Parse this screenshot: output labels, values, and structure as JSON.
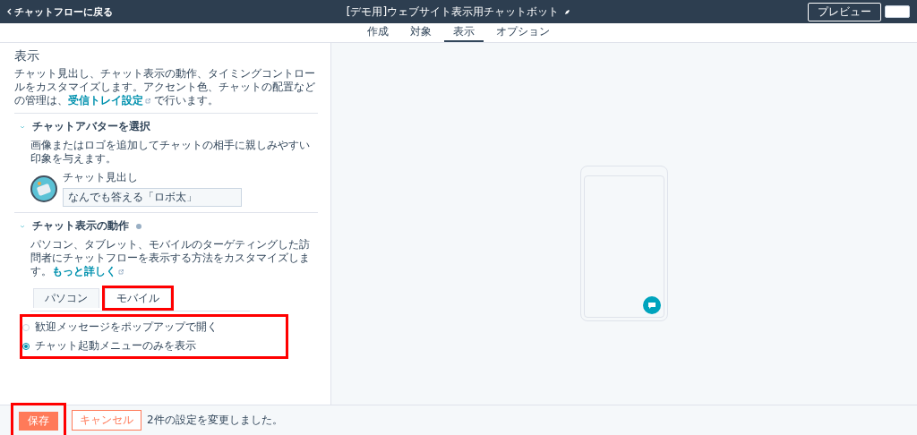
{
  "header": {
    "back_link": "チャットフローに戻る",
    "title": "[デモ用]ウェブサイト表示用チャットボット",
    "preview_button": "プレビュー"
  },
  "tabs": [
    {
      "label": "作成",
      "selected": false
    },
    {
      "label": "対象",
      "selected": false
    },
    {
      "label": "表示",
      "selected": true
    },
    {
      "label": "オプション",
      "selected": false
    }
  ],
  "panel": {
    "title": "表示",
    "description": "チャット見出し、チャット表示の動作、タイミングコントロールをカスタマイズします。アクセント色、チャットの配置などの管理は、",
    "description_link": "受信トレイ設定",
    "description_end": "で行います。",
    "sections": [
      {
        "kind": "avatar",
        "title": "チャットアバターを選択",
        "expanded": true,
        "text": "画像またはロゴを追加してチャットの相手に親しみやすい印象を与えます。",
        "field_label": "チャット見出し",
        "field_value": "なんでも答える「ロボ太」"
      },
      {
        "kind": "behavior",
        "title": "チャット表示の動作",
        "expanded": true,
        "text": "パソコン、タブレット、モバイルのターゲティングした訪問者にチャットフローを表示する方法をカスタマイズします。",
        "link": "もっと詳しく",
        "device_tabs": [
          {
            "label": "パソコン",
            "selected": false,
            "highlighted": false
          },
          {
            "label": "モバイル",
            "selected": true,
            "highlighted": true
          }
        ],
        "options_highlighted": true,
        "options": [
          {
            "label": "歓迎メッセージをポップアップで開く",
            "selected": false
          },
          {
            "label": "チャット起動メニューのみを表示",
            "selected": true
          }
        ]
      }
    ]
  },
  "footer": {
    "save_button": "保存",
    "save_highlighted": true,
    "cancel_button": "キャンセル",
    "status": "2件の設定を変更しました。"
  }
}
